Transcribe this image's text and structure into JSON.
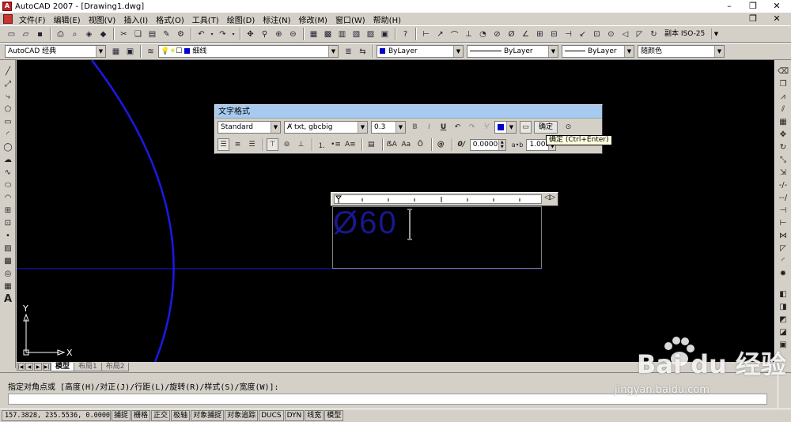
{
  "window": {
    "title": "AutoCAD 2007 - [Drawing1.dwg]"
  },
  "menu": [
    "文件(F)",
    "编辑(E)",
    "视图(V)",
    "插入(I)",
    "格式(O)",
    "工具(T)",
    "绘图(D)",
    "标注(N)",
    "修改(M)",
    "窗口(W)",
    "帮助(H)"
  ],
  "toolbar_styles": {
    "dimstyle": "副本 ISO-25"
  },
  "toolbar_layers": {
    "workspace": "AutoCAD 经典",
    "layer": "细线",
    "layer_color": "#0000cc",
    "color": "ByLayer",
    "linetype": "ByLayer",
    "lineweight": "ByLayer",
    "plotstyle": "随颜色"
  },
  "text_format": {
    "title": "文字格式",
    "style": "Standard",
    "font": "txt, gbcbig",
    "height": "0.3",
    "bold": "B",
    "italic": "I",
    "underline": "U",
    "color_swatch": "#0000cc",
    "ok_label": "确定",
    "oblique": "0.0000",
    "width_factor": "1.0000",
    "tooltip": "确定 (Ctrl+Enter)",
    "tracking_label": "a•b",
    "oblique_label": "0/",
    "at_label": "@"
  },
  "editor": {
    "text": "Ø60"
  },
  "ucs": {
    "x_label": "X",
    "y_label": "Y"
  },
  "layout_tabs": [
    "模型",
    "布局1",
    "布局2"
  ],
  "command": {
    "prompt": "指定对角点或 [高度(H)/对正(J)/行距(L)/旋转(R)/样式(S)/宽度(W)]:"
  },
  "status": {
    "coords": "157.3828, 235.5536, 0.0000",
    "buttons": [
      "捕捉",
      "栅格",
      "正交",
      "极轴",
      "对象捕捉",
      "对象追踪",
      "DUCS",
      "DYN",
      "线宽",
      "模型"
    ]
  },
  "watermark": {
    "brand": "Bai du 经验",
    "url": "jingyan.baidu.com"
  },
  "colors": {
    "canvas": "#000000",
    "geometry": "#1a1ae6",
    "ui": "#d4d0c8"
  }
}
